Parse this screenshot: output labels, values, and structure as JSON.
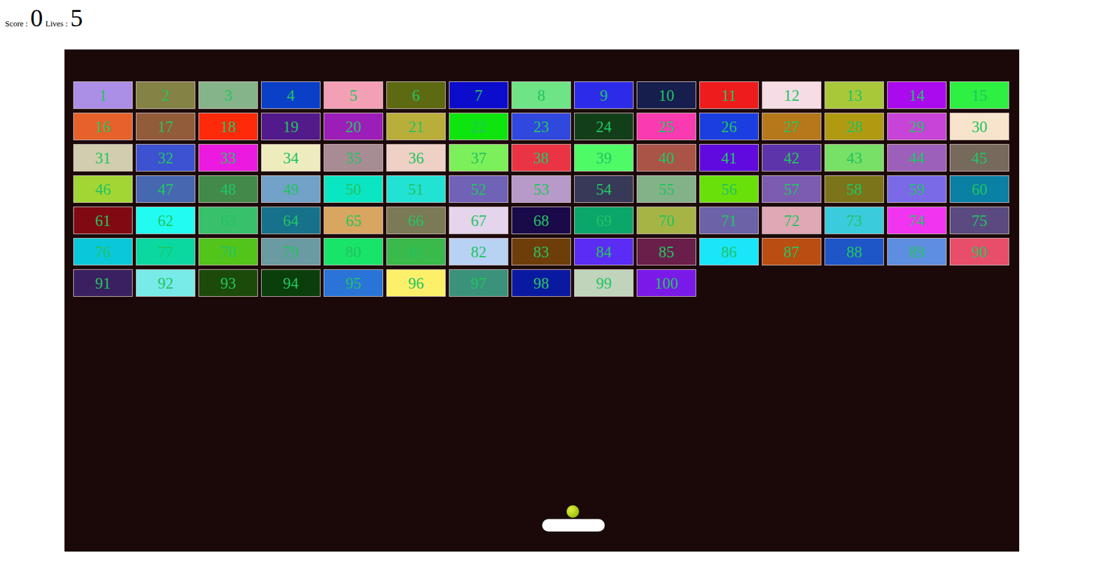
{
  "hud": {
    "score_label": "Score :",
    "score": "0",
    "lives_label": "Lives :",
    "lives": "5"
  },
  "bricks": [
    {
      "label": "1",
      "color": "#ab8ee6"
    },
    {
      "label": "2",
      "color": "#848244"
    },
    {
      "label": "3",
      "color": "#86b48a"
    },
    {
      "label": "4",
      "color": "#0a40c8"
    },
    {
      "label": "5",
      "color": "#f4a0b4"
    },
    {
      "label": "6",
      "color": "#5e6a12"
    },
    {
      "label": "7",
      "color": "#0c0ccc"
    },
    {
      "label": "8",
      "color": "#6ee486"
    },
    {
      "label": "9",
      "color": "#2c2ce8"
    },
    {
      "label": "10",
      "color": "#161e4e"
    },
    {
      "label": "11",
      "color": "#ee1c1c"
    },
    {
      "label": "12",
      "color": "#f6dce4"
    },
    {
      "label": "13",
      "color": "#a8c83a"
    },
    {
      "label": "14",
      "color": "#aa0aee"
    },
    {
      "label": "15",
      "color": "#2ef042"
    },
    {
      "label": "16",
      "color": "#e6622a"
    },
    {
      "label": "17",
      "color": "#925c3a"
    },
    {
      "label": "18",
      "color": "#fe2a0a"
    },
    {
      "label": "19",
      "color": "#521a8a"
    },
    {
      "label": "20",
      "color": "#9c1eb8"
    },
    {
      "label": "21",
      "color": "#baae3a"
    },
    {
      "label": "22",
      "color": "#0ee40e"
    },
    {
      "label": "23",
      "color": "#3048de"
    },
    {
      "label": "24",
      "color": "#123e1a"
    },
    {
      "label": "25",
      "color": "#fa3ab0"
    },
    {
      "label": "26",
      "color": "#1a3ee0"
    },
    {
      "label": "27",
      "color": "#b6781a"
    },
    {
      "label": "28",
      "color": "#b09a12"
    },
    {
      "label": "29",
      "color": "#c844d8"
    },
    {
      "label": "30",
      "color": "#f8e4cc"
    },
    {
      "label": "31",
      "color": "#d0ceae"
    },
    {
      "label": "32",
      "color": "#3c52d0"
    },
    {
      "label": "33",
      "color": "#ec1ae0"
    },
    {
      "label": "34",
      "color": "#eeecbe"
    },
    {
      "label": "35",
      "color": "#a88c94"
    },
    {
      "label": "36",
      "color": "#eed0c4"
    },
    {
      "label": "37",
      "color": "#7cf05a"
    },
    {
      "label": "38",
      "color": "#ea3444"
    },
    {
      "label": "39",
      "color": "#4efa66"
    },
    {
      "label": "40",
      "color": "#aa5448"
    },
    {
      "label": "41",
      "color": "#600ae0"
    },
    {
      "label": "42",
      "color": "#5e34aa"
    },
    {
      "label": "43",
      "color": "#78e066"
    },
    {
      "label": "44",
      "color": "#9c60ba"
    },
    {
      "label": "45",
      "color": "#766a5c"
    },
    {
      "label": "46",
      "color": "#a2d634"
    },
    {
      "label": "47",
      "color": "#4668b0"
    },
    {
      "label": "48",
      "color": "#428a4a"
    },
    {
      "label": "49",
      "color": "#72a2c8"
    },
    {
      "label": "50",
      "color": "#0ae6c2"
    },
    {
      "label": "51",
      "color": "#22e2d4"
    },
    {
      "label": "52",
      "color": "#7062b6"
    },
    {
      "label": "53",
      "color": "#b89ac8"
    },
    {
      "label": "54",
      "color": "#383858"
    },
    {
      "label": "55",
      "color": "#84b288"
    },
    {
      "label": "56",
      "color": "#6ae00a"
    },
    {
      "label": "57",
      "color": "#7c5cb0"
    },
    {
      "label": "58",
      "color": "#7c741a"
    },
    {
      "label": "59",
      "color": "#7a6ae8"
    },
    {
      "label": "60",
      "color": "#0a80a4"
    },
    {
      "label": "61",
      "color": "#800a12"
    },
    {
      "label": "62",
      "color": "#22fcf0"
    },
    {
      "label": "63",
      "color": "#38c06a"
    },
    {
      "label": "64",
      "color": "#16728a"
    },
    {
      "label": "65",
      "color": "#d8a660"
    },
    {
      "label": "66",
      "color": "#7a7a56"
    },
    {
      "label": "67",
      "color": "#e4d4ec"
    },
    {
      "label": "68",
      "color": "#1a0a4a"
    },
    {
      "label": "69",
      "color": "#0aa66a"
    },
    {
      "label": "70",
      "color": "#a6b446"
    },
    {
      "label": "71",
      "color": "#6c62a8"
    },
    {
      "label": "72",
      "color": "#e0a8b4"
    },
    {
      "label": "73",
      "color": "#3accdc"
    },
    {
      "label": "74",
      "color": "#f034f0"
    },
    {
      "label": "75",
      "color": "#5a4a80"
    },
    {
      "label": "76",
      "color": "#0ac8d8"
    },
    {
      "label": "77",
      "color": "#0ad8a0"
    },
    {
      "label": "78",
      "color": "#52c41a"
    },
    {
      "label": "79",
      "color": "#6a9aa2"
    },
    {
      "label": "80",
      "color": "#18e46a"
    },
    {
      "label": "81",
      "color": "#3aba4a"
    },
    {
      "label": "82",
      "color": "#b8d2f4"
    },
    {
      "label": "83",
      "color": "#6e3e0a"
    },
    {
      "label": "84",
      "color": "#5a2cf4"
    },
    {
      "label": "85",
      "color": "#6a1e4a"
    },
    {
      "label": "86",
      "color": "#1ae6fa"
    },
    {
      "label": "87",
      "color": "#ba4e12"
    },
    {
      "label": "88",
      "color": "#1e56c8"
    },
    {
      "label": "89",
      "color": "#5e8ee0"
    },
    {
      "label": "90",
      "color": "#e84e6a"
    },
    {
      "label": "91",
      "color": "#3a2060"
    },
    {
      "label": "92",
      "color": "#78eae8"
    },
    {
      "label": "93",
      "color": "#1c4a0a"
    },
    {
      "label": "94",
      "color": "#0a3e0a"
    },
    {
      "label": "95",
      "color": "#2a74d8"
    },
    {
      "label": "96",
      "color": "#fcf06a"
    },
    {
      "label": "97",
      "color": "#3a927a"
    },
    {
      "label": "98",
      "color": "#0a1aa0"
    },
    {
      "label": "99",
      "color": "#c0d4bc"
    },
    {
      "label": "100",
      "color": "#7a1ae8"
    }
  ]
}
